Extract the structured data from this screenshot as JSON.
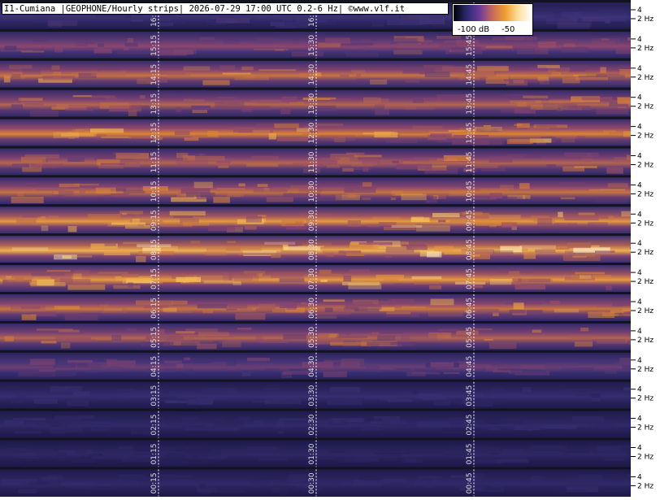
{
  "title": "I1-Cumiana |GEOPHONE/Hourly strips| 2026-07-29 17:00 UTC 0.2-6 Hz| ©www.vlf.it",
  "colorbar": {
    "tick_labels": [
      "-100 dB",
      "-50"
    ],
    "colors": [
      "#000000",
      "#2a2a6e",
      "#6a3a9a",
      "#c86a5a",
      "#f0a030",
      "#ffe0a0",
      "#ffffff"
    ]
  },
  "chart_data": {
    "type": "heatmap",
    "title": "I1-Cumiana |GEOPHONE/Hourly strips| 2026-07-29 17:00 UTC 0.2-6 Hz| ©www.vlf.it",
    "colorbar_ticks": [
      "-100 dB",
      "-50"
    ],
    "right_axis_ticks": [
      "4",
      "2 Hz"
    ],
    "strips": [
      {
        "labels": [
          "16:15",
          "16:30",
          "16:45"
        ],
        "intensity": 0.3
      },
      {
        "labels": [
          "15:15",
          "15:30",
          "15:45"
        ],
        "intensity": 0.55
      },
      {
        "labels": [
          "14:15",
          "14:30",
          "14:45"
        ],
        "intensity": 0.7
      },
      {
        "labels": [
          "13:15",
          "13:30",
          "13:45"
        ],
        "intensity": 0.65
      },
      {
        "labels": [
          "12:15",
          "12:30",
          "12:45"
        ],
        "intensity": 0.75
      },
      {
        "labels": [
          "11:15",
          "11:30",
          "11:45"
        ],
        "intensity": 0.65
      },
      {
        "labels": [
          "10:15",
          "10:30",
          "10:45"
        ],
        "intensity": 0.7
      },
      {
        "labels": [
          "09:15",
          "09:30",
          "09:45"
        ],
        "intensity": 0.8
      },
      {
        "labels": [
          "08:15",
          "08:30",
          "08:45"
        ],
        "intensity": 0.85
      },
      {
        "labels": [
          "07:15",
          "07:30",
          "07:45"
        ],
        "intensity": 0.8
      },
      {
        "labels": [
          "06:15",
          "06:30",
          "06:45"
        ],
        "intensity": 0.7
      },
      {
        "labels": [
          "05:15",
          "05:30",
          "05:45"
        ],
        "intensity": 0.65
      },
      {
        "labels": [
          "04:15",
          "04:30",
          "04:45"
        ],
        "intensity": 0.45
      },
      {
        "labels": [
          "03:15",
          "03:30",
          "03:45"
        ],
        "intensity": 0.25
      },
      {
        "labels": [
          "02:15",
          "02:30",
          "02:45"
        ],
        "intensity": 0.22
      },
      {
        "labels": [
          "01:15",
          "01:30",
          "01:45"
        ],
        "intensity": 0.2
      },
      {
        "labels": [
          "00:15",
          "00:30",
          "00:45"
        ],
        "intensity": 0.22
      }
    ]
  }
}
